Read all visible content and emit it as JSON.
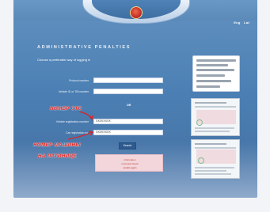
{
  "header": {
    "lang_links": [
      "Eng",
      "Lat"
    ]
  },
  "main": {
    "title": "ADMINISTRATIVE PENALTIES",
    "subtitle": "Choose a preferable way of logging in",
    "or_text": "OR",
    "fields": [
      {
        "label": "Protocol number",
        "value": ""
      },
      {
        "label": "Vehicle ID or TIN number",
        "value": ""
      },
      {
        "label": "Vehicle registration number",
        "value": "XX0XXXXX"
      },
      {
        "label": "Car registration no.",
        "value": "XX0XXXXX"
      }
    ],
    "search_label": "Search",
    "error_lines": [
      "Information",
      "not found check",
      "details again"
    ]
  },
  "annotations": {
    "stc": "НОМЕР СТС",
    "plate": "НОМЕР МАШИНЫ",
    "latin": "НА ЛАТИНИЦЕ",
    "color": "#e02020"
  },
  "colors": {
    "panel": "#4b7fb3",
    "accent": "#2f5a8e",
    "error_bg": "#f2d6dc"
  }
}
